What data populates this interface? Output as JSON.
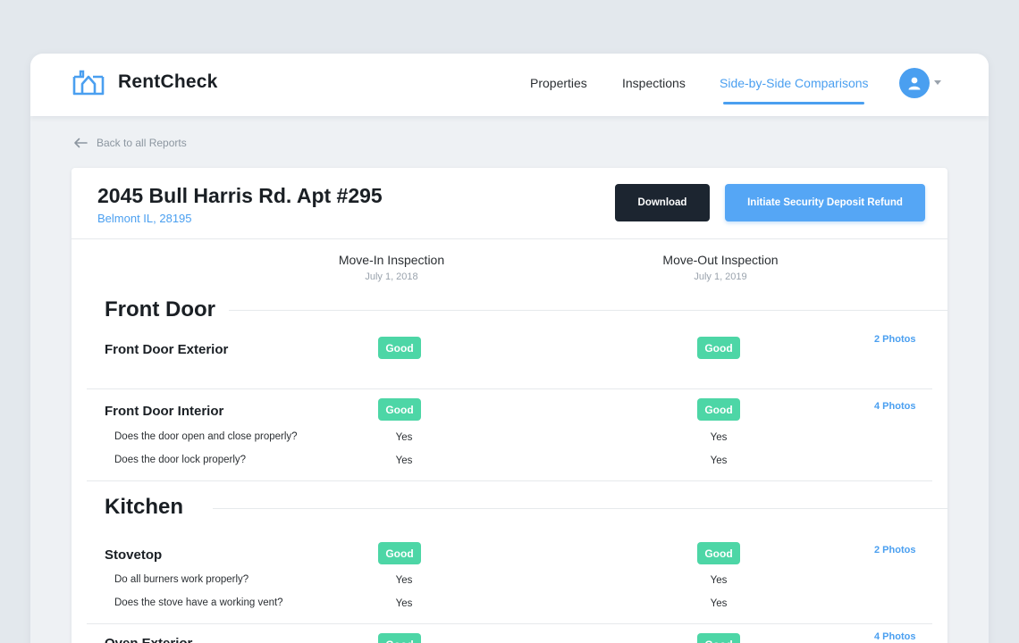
{
  "app": {
    "name": "RentCheck"
  },
  "nav": {
    "links": [
      "Properties",
      "Inspections",
      "Side-by-Side Comparisons"
    ],
    "active": "Side-by-Side Comparisons"
  },
  "back_link": "Back to all Reports",
  "property": {
    "address": "2045 Bull Harris Rd. Apt #295",
    "city": "Belmont IL, 28195"
  },
  "actions": {
    "download": "Download",
    "refund": "Initiate Security Deposit Refund"
  },
  "columns": [
    {
      "title": "Move-In Inspection",
      "date": "July 1, 2018"
    },
    {
      "title": "Move-Out Inspection",
      "date": "July 1, 2019"
    }
  ],
  "sections": [
    {
      "title": "Front Door",
      "items": [
        {
          "name": "Front Door Exterior",
          "move_in": "Good",
          "move_out": "Good",
          "photos": "2 Photos",
          "questions": []
        },
        {
          "name": "Front Door Interior",
          "move_in": "Good",
          "move_out": "Good",
          "photos": "4 Photos",
          "questions": [
            {
              "q": "Does the door open and close properly?",
              "move_in": "Yes",
              "move_out": "Yes"
            },
            {
              "q": "Does the door lock properly?",
              "move_in": "Yes",
              "move_out": "Yes"
            }
          ]
        }
      ]
    },
    {
      "title": "Kitchen",
      "items": [
        {
          "name": "Stovetop",
          "move_in": "Good",
          "move_out": "Good",
          "photos": "2 Photos",
          "questions": [
            {
              "q": "Do all burners work properly?",
              "move_in": "Yes",
              "move_out": "Yes"
            },
            {
              "q": "Does the stove have a working vent?",
              "move_in": "Yes",
              "move_out": "Yes"
            }
          ]
        },
        {
          "name": "Oven Exterior",
          "move_in": "Good",
          "move_out": "Good",
          "photos": "4 Photos",
          "questions": []
        }
      ]
    }
  ],
  "colors": {
    "accent": "#4a9ff0",
    "good": "#4dd6a6",
    "dark": "#1c2530"
  }
}
